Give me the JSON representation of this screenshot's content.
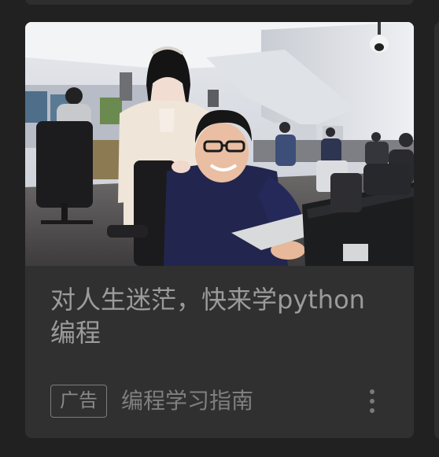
{
  "feed": {
    "ad_card": {
      "image": {
        "alt": "",
        "icon": "photo-office-people"
      },
      "title": "对人生迷茫，快来学python编程",
      "badge_label": "广告",
      "source": "编程学习指南",
      "more_icon": "more-vertical-icon"
    }
  },
  "colors": {
    "background": "#212121",
    "card": "#303030",
    "title_text": "#9b9b9b",
    "secondary_text": "#7f7f7f"
  }
}
